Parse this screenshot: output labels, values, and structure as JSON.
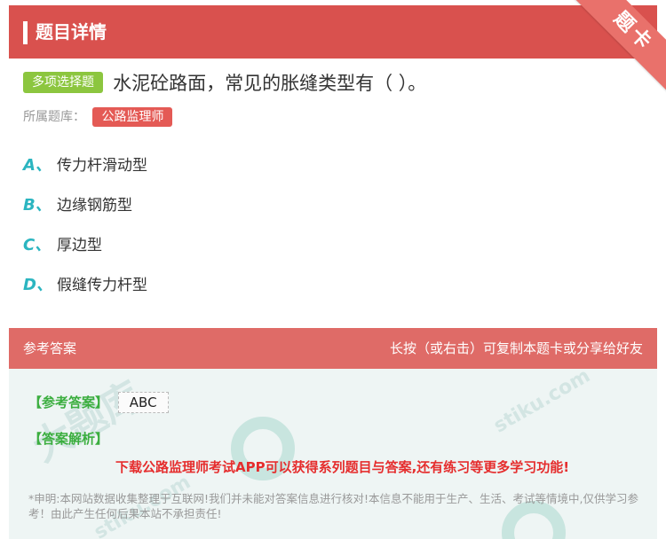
{
  "header": {
    "title": "题目详情",
    "ribbon": "题卡"
  },
  "question": {
    "type_badge": "多项选择题",
    "stem": "水泥砼路面，常见的胀缝类型有（   ）。",
    "bank_label": "所属题库：",
    "bank_tag": "公路监理师"
  },
  "options": [
    {
      "letter": "A、",
      "text": "传力杆滑动型"
    },
    {
      "letter": "B、",
      "text": "边缘钢筋型"
    },
    {
      "letter": "C、",
      "text": "厚边型"
    },
    {
      "letter": "D、",
      "text": "假缝传力杆型"
    }
  ],
  "answer": {
    "head_left": "参考答案",
    "head_right": "长按（或右击）可复制本题卡或分享给好友",
    "label": "【参考答案】",
    "value": "ABC",
    "analysis_label": "【答案解析】",
    "promo": "下载公路监理师考试APP可以获得系列题目与答案,还有练习等更多学习功能!",
    "disclaimer": "*申明:本网站数据收集整理于互联网!我们并未能对答案信息进行核对!本信息不能用于生产、生活、考试等情境中,仅供学习参考！由此产生任何后果本站不承担责任!"
  },
  "watermark": {
    "text_a": "大题库",
    "text_b": "stiku.com"
  },
  "colors": {
    "header": "#d9514e",
    "accent_teal": "#2bb5c0",
    "badge_green": "#8cc63f",
    "tag_red": "#e45a55",
    "promo_red": "#e52d2d"
  }
}
